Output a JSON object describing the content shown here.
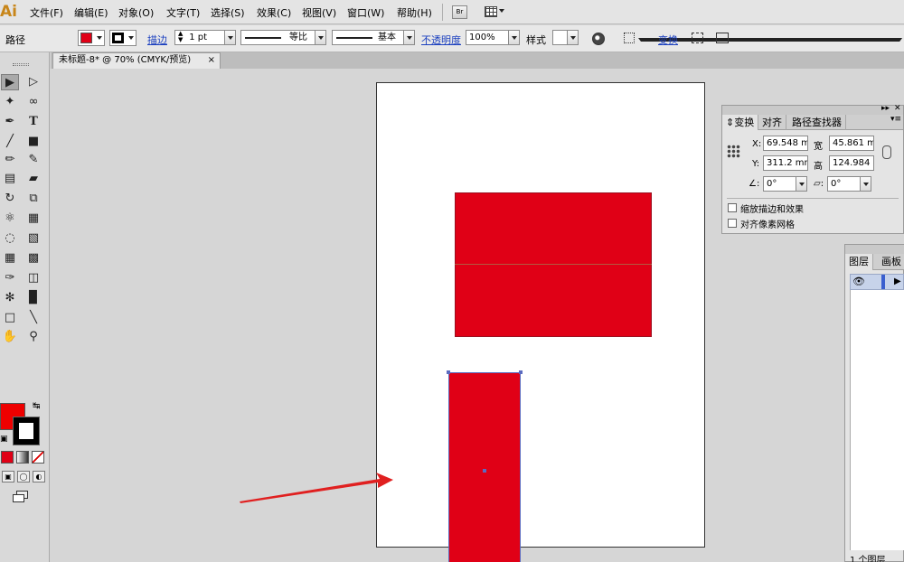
{
  "app": {
    "logo": "Ai",
    "accent": "#c8861a"
  },
  "menu": [
    "文件(F)",
    "编辑(E)",
    "对象(O)",
    "文字(T)",
    "选择(S)",
    "效果(C)",
    "视图(V)",
    "窗口(W)",
    "帮助(H)"
  ],
  "menu_extra": {
    "bridge_label": "Br",
    "workspace_icon": "arrange-documents-icon"
  },
  "control_bar": {
    "object_type": "路径",
    "fill_color": "#e00016",
    "stroke_label": "描边",
    "stroke_weight": "1 pt",
    "profile_label": "等比",
    "brush_label": "基本",
    "opacity_label": "不透明度",
    "opacity_value": "100%",
    "style_label": "样式",
    "transform_link": "变换"
  },
  "document": {
    "tab_title": "未标题-8* @ 70% (CMYK/预览)",
    "close": "×"
  },
  "canvas": {
    "shape_fill": "#e00016",
    "selection_color": "#5b6bc0"
  },
  "transform_panel": {
    "tabs": [
      "变换",
      "对齐",
      "路径查找器"
    ],
    "x_label": "X:",
    "x_value": "69.548 m",
    "y_label": "Y:",
    "y_value": "311.2 mm",
    "w_label": "宽",
    "w_value": "45.861 m",
    "h_label": "高",
    "h_value": "124.984",
    "rotate_value": "0°",
    "shear_value": "0°",
    "scale_strokes_label": "缩放描边和效果",
    "align_pixel_label": "对齐像素网格"
  },
  "layers_panel": {
    "tabs": [
      "图层",
      "画板"
    ],
    "footer": "1 个图层"
  }
}
